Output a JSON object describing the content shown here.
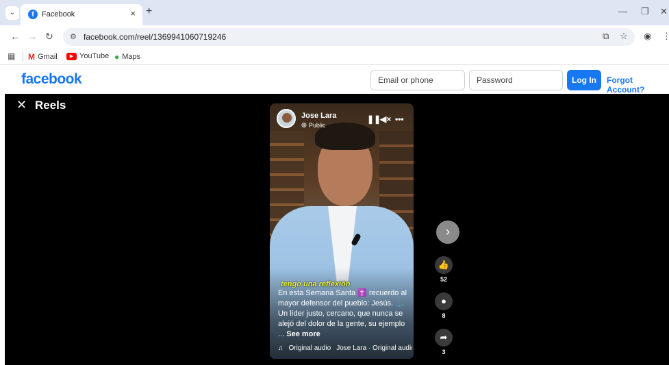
{
  "browser": {
    "tab_title": "Facebook",
    "tab_favicon": "f",
    "url": "facebook.com/reel/1369941060719246",
    "bookmarks": [
      {
        "label": "Gmail"
      },
      {
        "label": "YouTube"
      },
      {
        "label": "Maps"
      }
    ]
  },
  "header": {
    "logo": "facebook",
    "email_placeholder": "Email or phone",
    "password_placeholder": "Password",
    "login_label": "Log In",
    "forgot_label": "Forgot Account?"
  },
  "reels": {
    "title": "Reels",
    "post": {
      "author": "Jose Lara",
      "privacy": "Public",
      "subtitle": "tengo una reflexión",
      "caption": "En esta Semana Santa ✝️ recuerdo al mayor defensor del pueblo: Jesús. ⚖️ Un líder justo, cercano, que nunca se alejó del dolor de la gente, su ejemplo ...",
      "see_more": "See more",
      "audio_label": "Original audio",
      "audio_source": "Jose Lara · Original audio"
    },
    "actions": {
      "likes": "52",
      "comments": "8",
      "shares": "3"
    }
  },
  "colors": {
    "brand": "#1877f2",
    "reels_bg": "#000000",
    "chrome_bg": "#dfe6f3"
  },
  "icons": {
    "like": "thumbs-up-icon",
    "comment": "comment-icon",
    "share": "share-icon",
    "next": "chevron-right-icon"
  }
}
